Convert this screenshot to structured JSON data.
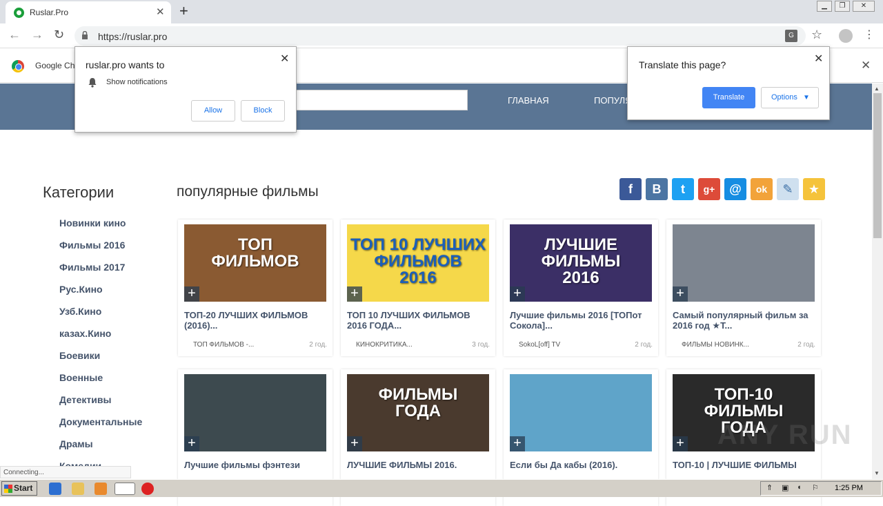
{
  "browser": {
    "tab_title": "Ruslar.Pro",
    "url": "https://ruslar.pro",
    "infobar_text": "Google Ch",
    "status": "Connecting..."
  },
  "notification_popup": {
    "title": "ruslar.pro wants to",
    "item": "Show notifications",
    "allow": "Allow",
    "block": "Block"
  },
  "translate_popup": {
    "title": "Translate this page?",
    "translate": "Translate",
    "options": "Options"
  },
  "site": {
    "nav": [
      "ГЛАВНАЯ",
      "ПОПУЛЯ"
    ],
    "categories_title": "Категории",
    "categories": [
      "Новинки кино",
      "Фильмы 2016",
      "Фильмы 2017",
      "Рус.Кино",
      "Узб.Кино",
      "казах.Кино",
      "Боевики",
      "Военные",
      "Детективы",
      "Документальные",
      "Драмы",
      "Комедии"
    ],
    "main_title": "популярные фильмы",
    "share_icons": [
      "facebook-icon",
      "vk-icon",
      "twitter-icon",
      "google-plus-icon",
      "mail-icon",
      "odnoklassniki-icon",
      "livejournal-icon",
      "favorites-star-icon"
    ],
    "cards": [
      {
        "title": "ТОП-20 ЛУЧШИХ ФИЛЬМОВ (2016)...",
        "channel": "ТОП ФИЛЬМОВ -...",
        "age": "2 год.",
        "thumb_text": "ТОП\nФИЛЬМОВ",
        "bg": "#8a5a32",
        "fg": "#ffffff"
      },
      {
        "title": "ТОП 10 ЛУЧШИХ ФИЛЬМОВ 2016 ГОДА...",
        "channel": "КИНОКРИТИКА...",
        "age": "3 год.",
        "thumb_text": "ТОП 10 ЛУЧШИХ\nФИЛЬМОВ\n2016",
        "bg": "#f5d84a",
        "fg": "#1c5fb8"
      },
      {
        "title": "Лучшие фильмы 2016 [ТОПот Сокола]...",
        "channel": "SokoL[off] TV",
        "age": "2 год.",
        "thumb_text": "ЛУЧШИЕ\nФИЛЬМЫ\n2016",
        "bg": "#3b2f66",
        "fg": "#ffffff"
      },
      {
        "title": "Самый популярный фильм за 2016 год ★Т...",
        "channel": "ФИЛЬМЫ НОВИНК...",
        "age": "2 год.",
        "thumb_text": "",
        "bg": "#7d8590",
        "fg": "#ffffff"
      },
      {
        "title": "Лучшие фильмы фэнтези",
        "channel": "",
        "age": "",
        "thumb_text": "",
        "bg": "#3d4a4f",
        "fg": "#ffffff"
      },
      {
        "title": "ЛУЧШИЕ ФИЛЬМЫ 2016.",
        "channel": "",
        "age": "",
        "thumb_text": "ФИЛЬМЫ\nГОДА",
        "bg": "#4a3a2e",
        "fg": "#ffffff"
      },
      {
        "title": "Если бы Да кабы (2016).",
        "channel": "",
        "age": "",
        "thumb_text": "",
        "bg": "#5fa4c9",
        "fg": "#ffffff"
      },
      {
        "title": "ТОП-10 | ЛУЧШИЕ ФИЛЬМЫ",
        "channel": "",
        "age": "",
        "thumb_text": "ТОП-10\nФИЛЬМЫ\nГОДА",
        "bg": "#2a2a2a",
        "fg": "#ffffff"
      }
    ]
  },
  "taskbar": {
    "start": "Start",
    "clock": "1:25 PM"
  },
  "watermark": "ANY RUN",
  "colors": {
    "header": "#5a7594",
    "link": "#44536a",
    "accent": "#4285f4"
  }
}
